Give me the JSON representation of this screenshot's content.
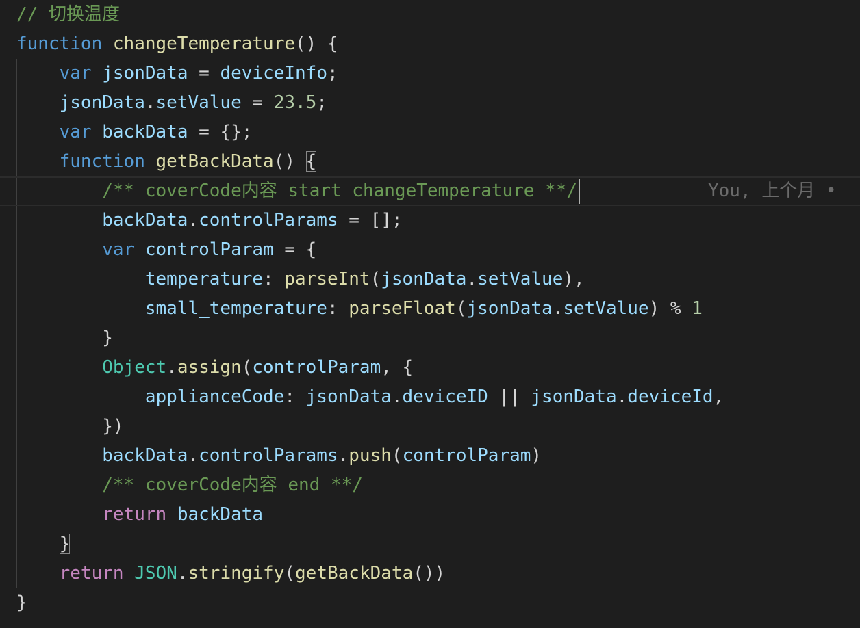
{
  "editor": {
    "lines": [
      {
        "tokens": [
          {
            "t": "// 切换温度",
            "k": "comment"
          }
        ]
      },
      {
        "tokens": [
          {
            "t": "function",
            "k": "keyword"
          },
          {
            "t": " ",
            "k": "punc"
          },
          {
            "t": "changeTemperature",
            "k": "func"
          },
          {
            "t": "() {",
            "k": "punc"
          }
        ]
      },
      {
        "tokens": [
          {
            "t": "    ",
            "k": "punc"
          },
          {
            "t": "var",
            "k": "keyword"
          },
          {
            "t": " ",
            "k": "punc"
          },
          {
            "t": "jsonData",
            "k": "var"
          },
          {
            "t": " = ",
            "k": "punc"
          },
          {
            "t": "deviceInfo",
            "k": "var"
          },
          {
            "t": ";",
            "k": "punc"
          }
        ]
      },
      {
        "tokens": [
          {
            "t": "    ",
            "k": "punc"
          },
          {
            "t": "jsonData",
            "k": "var"
          },
          {
            "t": ".",
            "k": "punc"
          },
          {
            "t": "setValue",
            "k": "var"
          },
          {
            "t": " = ",
            "k": "punc"
          },
          {
            "t": "23.5",
            "k": "number"
          },
          {
            "t": ";",
            "k": "punc"
          }
        ]
      },
      {
        "tokens": [
          {
            "t": "    ",
            "k": "punc"
          },
          {
            "t": "var",
            "k": "keyword"
          },
          {
            "t": " ",
            "k": "punc"
          },
          {
            "t": "backData",
            "k": "var"
          },
          {
            "t": " = {};",
            "k": "punc"
          }
        ]
      },
      {
        "tokens": [
          {
            "t": "    ",
            "k": "punc"
          },
          {
            "t": "function",
            "k": "keyword"
          },
          {
            "t": " ",
            "k": "punc"
          },
          {
            "t": "getBackData",
            "k": "func"
          },
          {
            "t": "() ",
            "k": "punc"
          },
          {
            "t": "{",
            "k": "punc",
            "match": true
          }
        ]
      },
      {
        "current": true,
        "tokens": [
          {
            "t": "        ",
            "k": "punc"
          },
          {
            "t": "/** coverCode内容 start changeTemperature **/",
            "k": "comment"
          }
        ],
        "blame": "You, 上个月 •"
      },
      {
        "tokens": [
          {
            "t": "        ",
            "k": "punc"
          },
          {
            "t": "backData",
            "k": "var"
          },
          {
            "t": ".",
            "k": "punc"
          },
          {
            "t": "controlParams",
            "k": "var"
          },
          {
            "t": " = [];",
            "k": "punc"
          }
        ]
      },
      {
        "tokens": [
          {
            "t": "        ",
            "k": "punc"
          },
          {
            "t": "var",
            "k": "keyword"
          },
          {
            "t": " ",
            "k": "punc"
          },
          {
            "t": "controlParam",
            "k": "var"
          },
          {
            "t": " = {",
            "k": "punc"
          }
        ]
      },
      {
        "tokens": [
          {
            "t": "            ",
            "k": "punc"
          },
          {
            "t": "temperature",
            "k": "var"
          },
          {
            "t": ": ",
            "k": "punc"
          },
          {
            "t": "parseInt",
            "k": "func"
          },
          {
            "t": "(",
            "k": "punc"
          },
          {
            "t": "jsonData",
            "k": "var"
          },
          {
            "t": ".",
            "k": "punc"
          },
          {
            "t": "setValue",
            "k": "var"
          },
          {
            "t": "),",
            "k": "punc"
          }
        ]
      },
      {
        "tokens": [
          {
            "t": "            ",
            "k": "punc"
          },
          {
            "t": "small_temperature",
            "k": "var"
          },
          {
            "t": ": ",
            "k": "punc"
          },
          {
            "t": "parseFloat",
            "k": "func"
          },
          {
            "t": "(",
            "k": "punc"
          },
          {
            "t": "jsonData",
            "k": "var"
          },
          {
            "t": ".",
            "k": "punc"
          },
          {
            "t": "setValue",
            "k": "var"
          },
          {
            "t": ") % ",
            "k": "punc"
          },
          {
            "t": "1",
            "k": "number"
          }
        ]
      },
      {
        "tokens": [
          {
            "t": "        }",
            "k": "punc"
          }
        ]
      },
      {
        "tokens": [
          {
            "t": "        ",
            "k": "punc"
          },
          {
            "t": "Object",
            "k": "class"
          },
          {
            "t": ".",
            "k": "punc"
          },
          {
            "t": "assign",
            "k": "func"
          },
          {
            "t": "(",
            "k": "punc"
          },
          {
            "t": "controlParam",
            "k": "var"
          },
          {
            "t": ", {",
            "k": "punc"
          }
        ]
      },
      {
        "tokens": [
          {
            "t": "            ",
            "k": "punc"
          },
          {
            "t": "applianceCode",
            "k": "var"
          },
          {
            "t": ": ",
            "k": "punc"
          },
          {
            "t": "jsonData",
            "k": "var"
          },
          {
            "t": ".",
            "k": "punc"
          },
          {
            "t": "deviceID",
            "k": "var"
          },
          {
            "t": " || ",
            "k": "punc"
          },
          {
            "t": "jsonData",
            "k": "var"
          },
          {
            "t": ".",
            "k": "punc"
          },
          {
            "t": "deviceId",
            "k": "var"
          },
          {
            "t": ",",
            "k": "punc"
          }
        ]
      },
      {
        "tokens": [
          {
            "t": "        })",
            "k": "punc"
          }
        ]
      },
      {
        "tokens": [
          {
            "t": "        ",
            "k": "punc"
          },
          {
            "t": "backData",
            "k": "var"
          },
          {
            "t": ".",
            "k": "punc"
          },
          {
            "t": "controlParams",
            "k": "var"
          },
          {
            "t": ".",
            "k": "punc"
          },
          {
            "t": "push",
            "k": "func"
          },
          {
            "t": "(",
            "k": "punc"
          },
          {
            "t": "controlParam",
            "k": "var"
          },
          {
            "t": ")",
            "k": "punc"
          }
        ]
      },
      {
        "tokens": [
          {
            "t": "        ",
            "k": "punc"
          },
          {
            "t": "/** coverCode内容 end **/",
            "k": "comment"
          }
        ]
      },
      {
        "tokens": [
          {
            "t": "        ",
            "k": "punc"
          },
          {
            "t": "return",
            "k": "control"
          },
          {
            "t": " ",
            "k": "punc"
          },
          {
            "t": "backData",
            "k": "var"
          }
        ]
      },
      {
        "tokens": [
          {
            "t": "    ",
            "k": "punc"
          },
          {
            "t": "}",
            "k": "punc",
            "match": true
          }
        ]
      },
      {
        "tokens": [
          {
            "t": "    ",
            "k": "punc"
          },
          {
            "t": "return",
            "k": "control"
          },
          {
            "t": " ",
            "k": "punc"
          },
          {
            "t": "JSON",
            "k": "class"
          },
          {
            "t": ".",
            "k": "punc"
          },
          {
            "t": "stringify",
            "k": "func"
          },
          {
            "t": "(",
            "k": "punc"
          },
          {
            "t": "getBackData",
            "k": "func"
          },
          {
            "t": "())",
            "k": "punc"
          }
        ]
      },
      {
        "tokens": [
          {
            "t": "}",
            "k": "punc"
          }
        ]
      }
    ]
  }
}
